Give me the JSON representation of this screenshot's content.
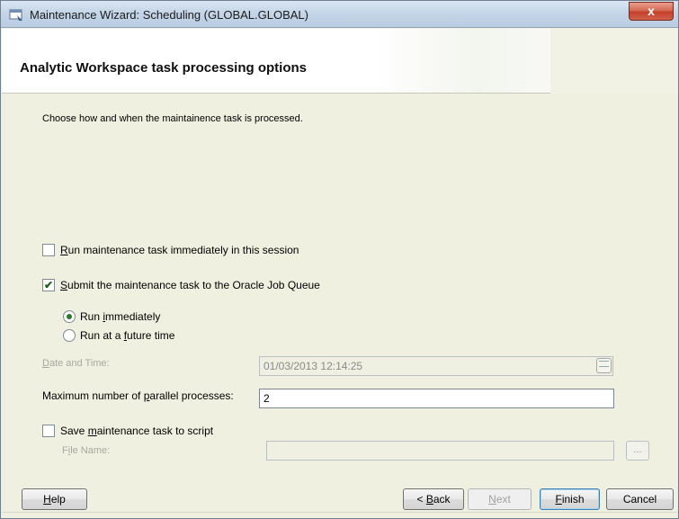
{
  "window": {
    "title": "Maintenance Wizard: Scheduling (GLOBAL.GLOBAL)",
    "close_glyph": "x"
  },
  "header": {
    "title": "Analytic Workspace task processing options"
  },
  "body": {
    "description": "Choose how and when the maintainence task is processed.",
    "run_immediately_session": {
      "mnemonic": "R",
      "rest": "un maintenance task immediately in this session",
      "checked": false
    },
    "submit_job_queue": {
      "mnemonic": "S",
      "rest": "ubmit the maintenance task to the Oracle Job Queue",
      "checked": true
    },
    "radio_run_immediately": {
      "pre": "Run ",
      "mnemonic": "i",
      "post": "mmediately",
      "selected": true
    },
    "radio_future": {
      "pre": "Run at a ",
      "mnemonic": "f",
      "post": "uture time",
      "selected": false
    },
    "date_time": {
      "label_mnemonic": "D",
      "label_rest": "ate and Time:",
      "value": "01/03/2013 12:14:25"
    },
    "parallel": {
      "label_pre": "Maximum number of ",
      "label_mnemonic": "p",
      "label_post": "arallel processes:",
      "value": "2"
    },
    "save_script": {
      "pre": "Save ",
      "mnemonic": "m",
      "post": "aintenance task to script",
      "checked": false
    },
    "file_name": {
      "label_pre": "F",
      "label_mnemonic": "i",
      "label_post": "le Name:",
      "value": "",
      "browse_label": "..."
    }
  },
  "footer": {
    "help": {
      "mnemonic": "H",
      "rest": "elp"
    },
    "back": {
      "pre": "< ",
      "mnemonic": "B",
      "rest": "ack"
    },
    "next": {
      "mnemonic": "N",
      "rest": "ext"
    },
    "finish": {
      "mnemonic": "F",
      "rest": "inish"
    },
    "cancel": "Cancel"
  }
}
